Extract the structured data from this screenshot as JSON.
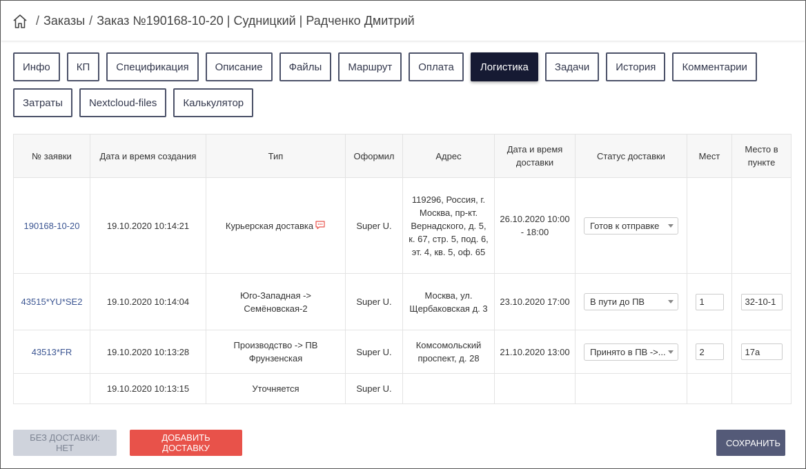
{
  "breadcrumb": {
    "items": [
      "Заказы",
      "Заказ №190168-10-20 | Судницкий | Радченко Дмитрий"
    ],
    "separator": "/"
  },
  "tabs": [
    {
      "label": "Инфо",
      "active": false
    },
    {
      "label": "КП",
      "active": false
    },
    {
      "label": "Спецификация",
      "active": false
    },
    {
      "label": "Описание",
      "active": false
    },
    {
      "label": "Файлы",
      "active": false
    },
    {
      "label": "Маршрут",
      "active": false
    },
    {
      "label": "Оплата",
      "active": false
    },
    {
      "label": "Логистика",
      "active": true
    },
    {
      "label": "Задачи",
      "active": false
    },
    {
      "label": "История",
      "active": false
    },
    {
      "label": "Комментарии",
      "active": false
    },
    {
      "label": "Затраты",
      "active": false
    },
    {
      "label": "Nextcloud-files",
      "active": false
    },
    {
      "label": "Калькулятор",
      "active": false
    }
  ],
  "table": {
    "headers": [
      "№ заявки",
      "Дата и время создания",
      "Тип",
      "Оформил",
      "Адрес",
      "Дата и время доставки",
      "Статус доставки",
      "Мест",
      "Место в пункте"
    ],
    "rows": [
      {
        "id": "190168-10-20",
        "created": "19.10.2020 10:14:21",
        "type": "Курьерская доставка",
        "has_comment": true,
        "author": "Super U.",
        "address": "119296, Россия, г. Москва, пр-кт. Вернадского, д. 5, к. 67, стр. 5, под. 6, эт. 4, кв. 5, оф. 65",
        "delivery": "26.10.2020 10:00 - 18:00",
        "status": "Готов к отправке",
        "places": "",
        "point_place": ""
      },
      {
        "id": "43515*YU*SE2",
        "created": "19.10.2020 10:14:04",
        "type": "Юго-Западная -> Семёновская-2",
        "has_comment": false,
        "author": "Super U.",
        "address": "Москва, ул. Щербаковская д. 3",
        "delivery": "23.10.2020 17:00",
        "status": "В пути до ПВ",
        "places": "1",
        "point_place": "32-10-1"
      },
      {
        "id": "43513*FR",
        "created": "19.10.2020 10:13:28",
        "type": "Производство -> ПВ Фрунзенская",
        "has_comment": false,
        "author": "Super U.",
        "address": "Комсомольский проспект, д. 28",
        "delivery": "21.10.2020 13:00",
        "status": "Принято в ПВ ->...",
        "places": "2",
        "point_place": "17a"
      },
      {
        "id": "",
        "created": "19.10.2020 10:13:15",
        "type": "Уточняется",
        "has_comment": false,
        "author": "Super U.",
        "address": "",
        "delivery": "",
        "status": "",
        "places": "",
        "point_place": ""
      }
    ]
  },
  "buttons": {
    "no_delivery": "Без доставки: нет",
    "add_delivery": "Добавить доставку",
    "save": "Сохранить"
  },
  "colors": {
    "active_tab": "#161a33",
    "tab_border": "#4b5168",
    "link": "#3b5592",
    "add_button": "#e8524a",
    "save_button": "#545a78",
    "disabled_button": "#cfd3dc"
  }
}
